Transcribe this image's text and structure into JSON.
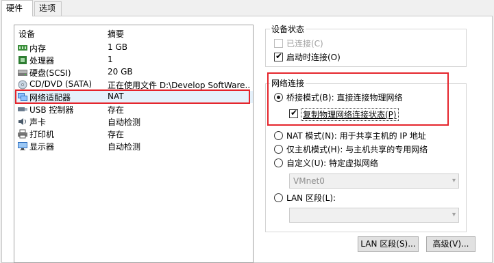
{
  "tabs": {
    "hardware": "硬件",
    "options": "选项"
  },
  "device_list": {
    "header_device": "设备",
    "header_summary": "摘要",
    "items": [
      {
        "icon": "memory-icon",
        "name": "内存",
        "summary": "1 GB"
      },
      {
        "icon": "cpu-icon",
        "name": "处理器",
        "summary": "1"
      },
      {
        "icon": "hard-disk-icon",
        "name": "硬盘(SCSI)",
        "summary": "20 GB"
      },
      {
        "icon": "cd-dvd-icon",
        "name": "CD/DVD (SATA)",
        "summary": "正在使用文件 D:\\Develop SoftWare..."
      },
      {
        "icon": "network-adapter-icon",
        "name": "网络适配器",
        "summary": "NAT"
      },
      {
        "icon": "usb-controller-icon",
        "name": "USB 控制器",
        "summary": "存在"
      },
      {
        "icon": "sound-card-icon",
        "name": "声卡",
        "summary": "自动检测"
      },
      {
        "icon": "printer-icon",
        "name": "打印机",
        "summary": "存在"
      },
      {
        "icon": "display-icon",
        "name": "显示器",
        "summary": "自动检测"
      }
    ]
  },
  "device_status": {
    "title": "设备状态",
    "connected_label": "已连接(C)",
    "connect_on_power_on_label": "启动时连接(O)"
  },
  "network": {
    "title": "网络连接",
    "bridged_label": "桥接模式(B): 直接连接物理网络",
    "replicate_label": "复制物理网络连接状态(P)",
    "nat_label": "NAT 模式(N): 用于共享主机的 IP 地址",
    "host_only_label": "仅主机模式(H): 与主机共享的专用网络",
    "custom_label": "自定义(U): 特定虚拟网络",
    "custom_value": "VMnet0",
    "lan_segment_label": "LAN 区段(L):",
    "lan_segment_value": ""
  },
  "buttons": {
    "lan_segments": "LAN 区段(S)...",
    "advanced": "高级(V)..."
  },
  "colors": {
    "highlight_border": "#e5242b",
    "selection": "#e5f1fb"
  }
}
